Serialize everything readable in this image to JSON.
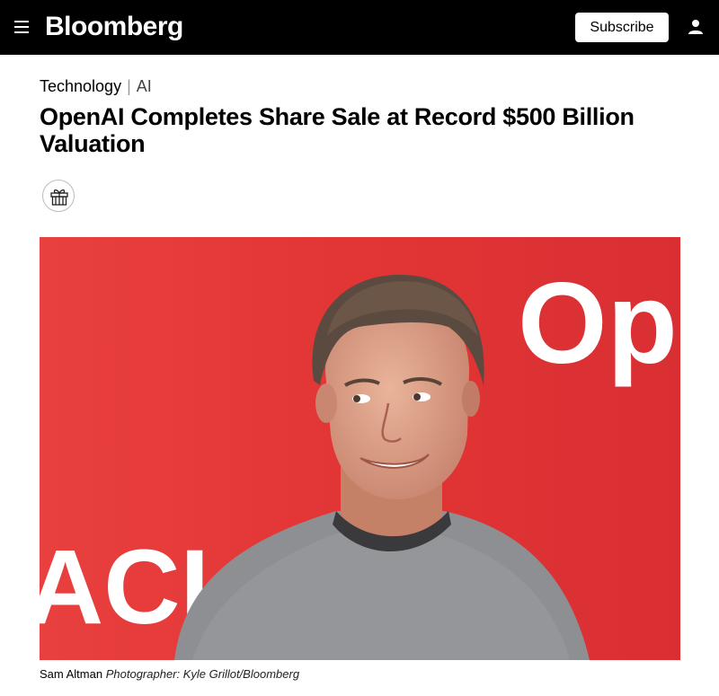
{
  "header": {
    "logo": "Bloomberg",
    "subscribe_label": "Subscribe",
    "background": "#000000"
  },
  "article": {
    "section": "Technology",
    "separator": "|",
    "subsection": "AI",
    "headline": "OpenAI Completes Share Sale at Record $500 Billion Valuation",
    "photo": {
      "background_color": "#e23a3a",
      "backdrop_text_right": "Op",
      "backdrop_text_left": "ACI"
    },
    "caption": {
      "subject": "Sam Altman",
      "credit": "Photographer: Kyle Grillot/Bloomberg"
    }
  },
  "icons": {
    "menu": "hamburger-menu-icon",
    "user": "user-icon",
    "gift": "gift-icon"
  }
}
